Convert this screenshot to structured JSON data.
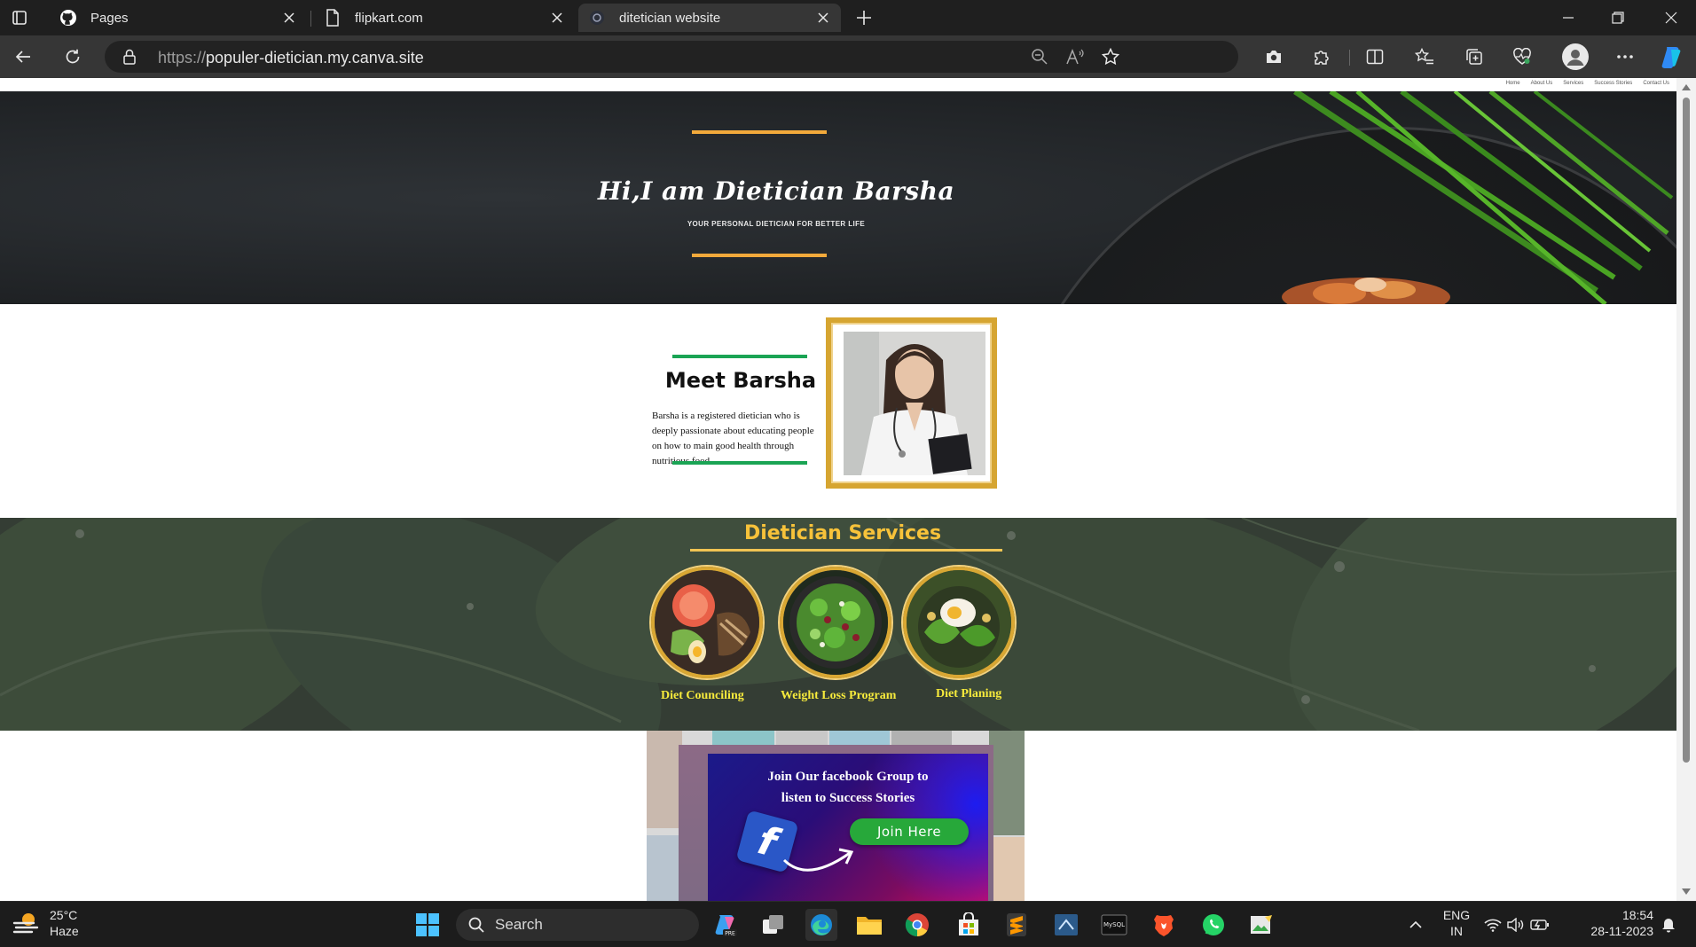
{
  "browser": {
    "tabs": [
      {
        "title": "Pages",
        "favicon": "github-icon"
      },
      {
        "title": "flipkart.com",
        "favicon": "page-icon"
      },
      {
        "title": "ditetician website",
        "favicon": "canva-icon",
        "active": true
      }
    ],
    "url_scheme": "https://",
    "url_host": "populer-dietician.my.canva.site"
  },
  "site": {
    "nav": [
      "Home",
      "About Us",
      "Services",
      "Success Stories",
      "Contact Us"
    ],
    "hero": {
      "title": "Hi,I am Dietician Barsha",
      "subtitle": "YOUR PERSONAL DIETICIAN FOR BETTER LIFE"
    },
    "meet": {
      "title": "Meet Barsha",
      "text": "Barsha is a registered dietician who is deeply passionate about educating people on how to main good health through nutritious food."
    },
    "services": {
      "title": "Dietician Services",
      "items": [
        {
          "label": "Diet Counciling"
        },
        {
          "label": "Weight Loss Program"
        },
        {
          "label": "Diet Planing"
        }
      ]
    },
    "facebook_card": {
      "heading_line1": "Join Our facebook Group to",
      "heading_line2": "listen to Success Stories",
      "logo_letter": "f",
      "button": "Join Here"
    }
  },
  "colors": {
    "accent_gold": "#f2a93b",
    "accent_green": "#1aa454",
    "services_title": "#f7c23a",
    "service_label": "#f6ea3c",
    "join_button": "#27a83a"
  },
  "taskbar": {
    "weather_temp": "25°C",
    "weather_desc": "Haze",
    "search_label": "Search",
    "lang_line1": "ENG",
    "lang_line2": "IN",
    "time": "18:54",
    "date": "28-11-2023"
  }
}
